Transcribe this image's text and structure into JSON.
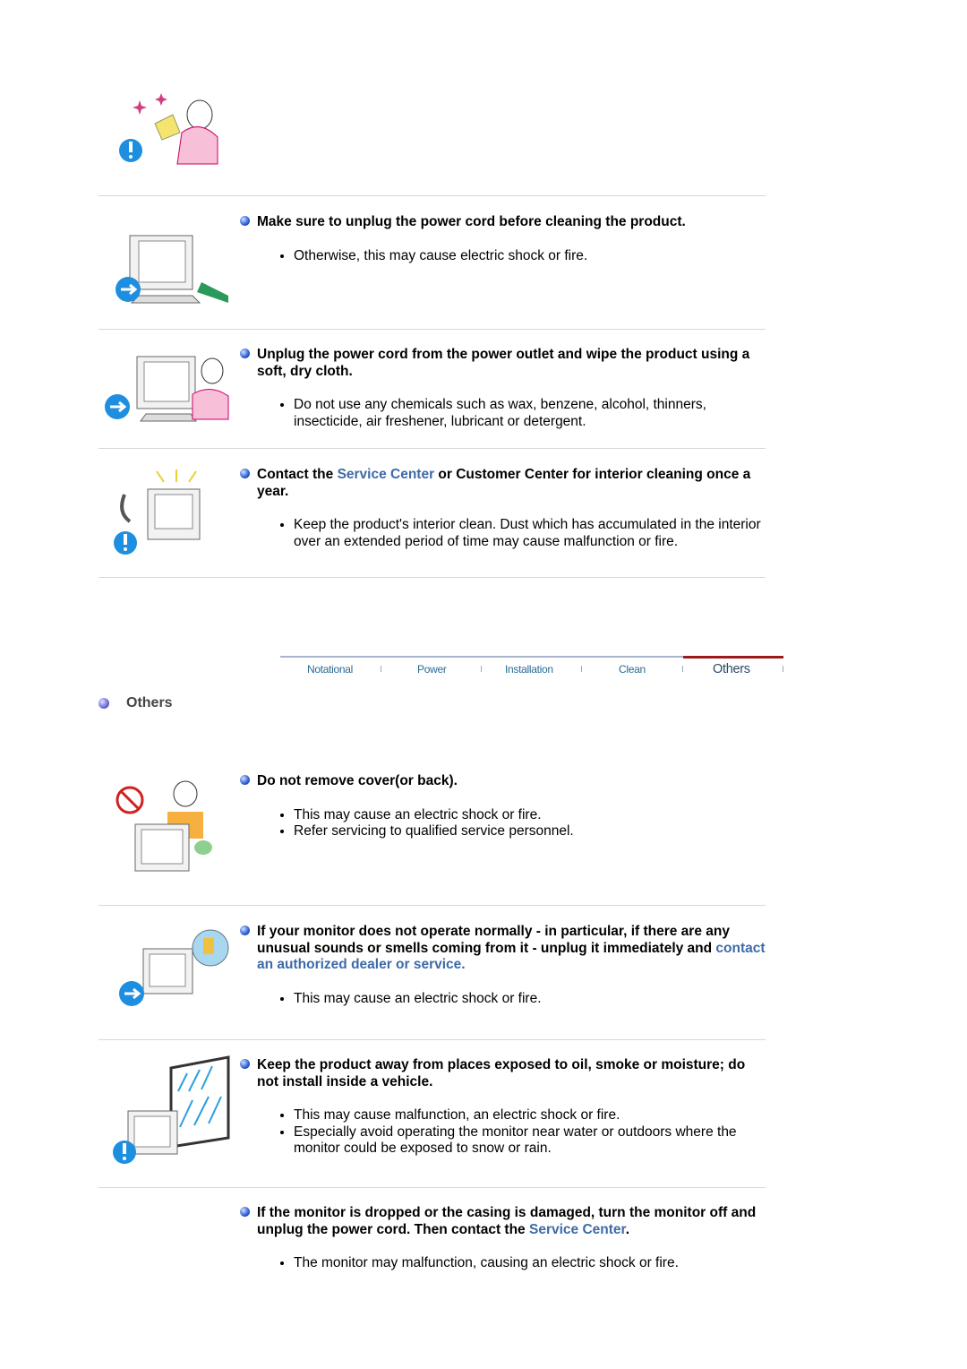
{
  "top_sections": [
    {
      "heading": [
        "Make sure to unplug the power cord before cleaning the product."
      ],
      "bullets": [
        "Otherwise, this may cause electric shock or fire."
      ]
    },
    {
      "heading": [
        "Unplug the power cord from the power outlet and wipe the product using a soft, dry cloth."
      ],
      "bullets": [
        "Do not use any chemicals such as wax, benzene, alcohol, thinners, insecticide, air freshener, lubricant or detergent."
      ]
    },
    {
      "heading_pre": "Contact the ",
      "heading_link": "Service Center",
      "heading_post": " or Customer Center for interior cleaning once a year.",
      "bullets": [
        "Keep the product's interior clean. Dust which has accumulated in the interior over an extended period of time may cause malfunction or fire."
      ]
    }
  ],
  "tabs": [
    {
      "label": "Notational"
    },
    {
      "label": "Power"
    },
    {
      "label": "Installation"
    },
    {
      "label": "Clean"
    },
    {
      "label": "Others",
      "active": true
    }
  ],
  "section_title": "Others",
  "others_sections": [
    {
      "heading": "Do not remove cover(or back).",
      "bullets": [
        "This may cause an electric shock or fire.",
        "Refer servicing to qualified service personnel."
      ]
    },
    {
      "heading_pre": "If your monitor does not operate normally - in particular, if there are any unusual sounds or smells coming from it - unplug it immediately and ",
      "heading_link": "contact an authorized dealer or service",
      "heading_post": ".",
      "bullets": [
        "This may cause an electric shock or fire."
      ]
    },
    {
      "heading": "Keep the product away from places exposed to oil, smoke or moisture; do not install inside a vehicle.",
      "bullets": [
        "This may cause malfunction, an electric shock or fire.",
        "Especially avoid operating the monitor near water or outdoors where the monitor could be exposed to snow or rain."
      ]
    },
    {
      "heading_pre": "If the monitor is dropped or the casing is damaged, turn the monitor off and unplug the power cord. Then contact the ",
      "heading_link": "Service Center",
      "heading_post": ".",
      "bullets": [
        "The monitor may malfunction, causing an electric shock or fire."
      ]
    }
  ],
  "colors": {
    "link": "#3d6aa8",
    "tab_text": "#2a6a92",
    "tab_active_bar": "#9a1b1b"
  }
}
